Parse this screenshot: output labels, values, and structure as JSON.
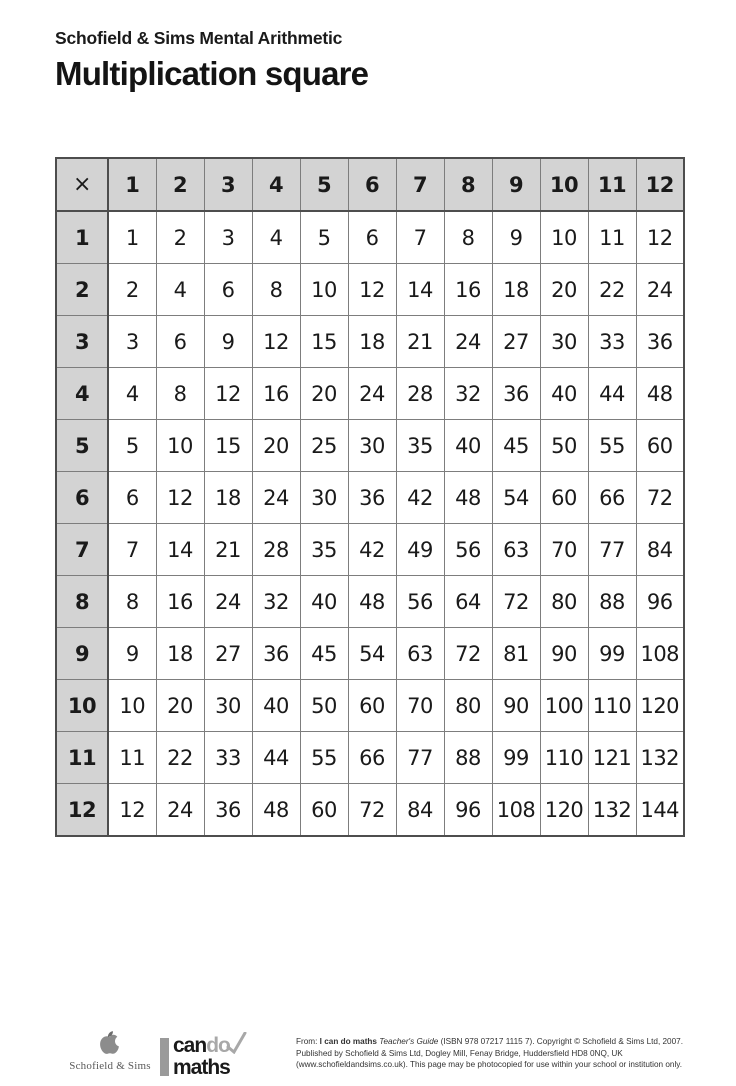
{
  "header": {
    "eyebrow": "Schofield & Sims Mental Arithmetic",
    "title": "Multiplication square"
  },
  "grid": {
    "corner_symbol": "×",
    "column_headers": [
      "1",
      "2",
      "3",
      "4",
      "5",
      "6",
      "7",
      "8",
      "9",
      "10",
      "11",
      "12"
    ],
    "row_headers": [
      "1",
      "2",
      "3",
      "4",
      "5",
      "6",
      "7",
      "8",
      "9",
      "10",
      "11",
      "12"
    ],
    "rows": [
      [
        "1",
        "2",
        "3",
        "4",
        "5",
        "6",
        "7",
        "8",
        "9",
        "10",
        "11",
        "12"
      ],
      [
        "2",
        "4",
        "6",
        "8",
        "10",
        "12",
        "14",
        "16",
        "18",
        "20",
        "22",
        "24"
      ],
      [
        "3",
        "6",
        "9",
        "12",
        "15",
        "18",
        "21",
        "24",
        "27",
        "30",
        "33",
        "36"
      ],
      [
        "4",
        "8",
        "12",
        "16",
        "20",
        "24",
        "28",
        "32",
        "36",
        "40",
        "44",
        "48"
      ],
      [
        "5",
        "10",
        "15",
        "20",
        "25",
        "30",
        "35",
        "40",
        "45",
        "50",
        "55",
        "60"
      ],
      [
        "6",
        "12",
        "18",
        "24",
        "30",
        "36",
        "42",
        "48",
        "54",
        "60",
        "66",
        "72"
      ],
      [
        "7",
        "14",
        "21",
        "28",
        "35",
        "42",
        "49",
        "56",
        "63",
        "70",
        "77",
        "84"
      ],
      [
        "8",
        "16",
        "24",
        "32",
        "40",
        "48",
        "56",
        "64",
        "72",
        "80",
        "88",
        "96"
      ],
      [
        "9",
        "18",
        "27",
        "36",
        "45",
        "54",
        "63",
        "72",
        "81",
        "90",
        "99",
        "108"
      ],
      [
        "10",
        "20",
        "30",
        "40",
        "50",
        "60",
        "70",
        "80",
        "90",
        "100",
        "110",
        "120"
      ],
      [
        "11",
        "22",
        "33",
        "44",
        "55",
        "66",
        "77",
        "88",
        "99",
        "110",
        "121",
        "132"
      ],
      [
        "12",
        "24",
        "36",
        "48",
        "60",
        "72",
        "84",
        "96",
        "108",
        "120",
        "132",
        "144"
      ]
    ],
    "header_background": "#d3d3d3",
    "border_color": "#4d4d4d"
  },
  "footer": {
    "schofield_logo": {
      "wordmark": "Schofield & Sims",
      "icon": "apple-icon"
    },
    "icandomaths_logo": {
      "can": "can",
      "do": "do",
      "maths": "maths"
    },
    "copyright": {
      "line1_prefix": "From: ",
      "line1_bold": "I can do maths",
      "line1_italic": " Teacher's Guide",
      "line1_suffix": " (ISBN 978 07217 1115 7). Copyright © Schofield & Sims Ltd, 2007.",
      "line2": "Published by Schofield & Sims Ltd, Dogley Mill, Fenay Bridge, Huddersfield HD8 0NQ, UK",
      "line3": "(www.schofieldandsims.co.uk). This page may be photocopied for use within your school or institution only."
    }
  }
}
